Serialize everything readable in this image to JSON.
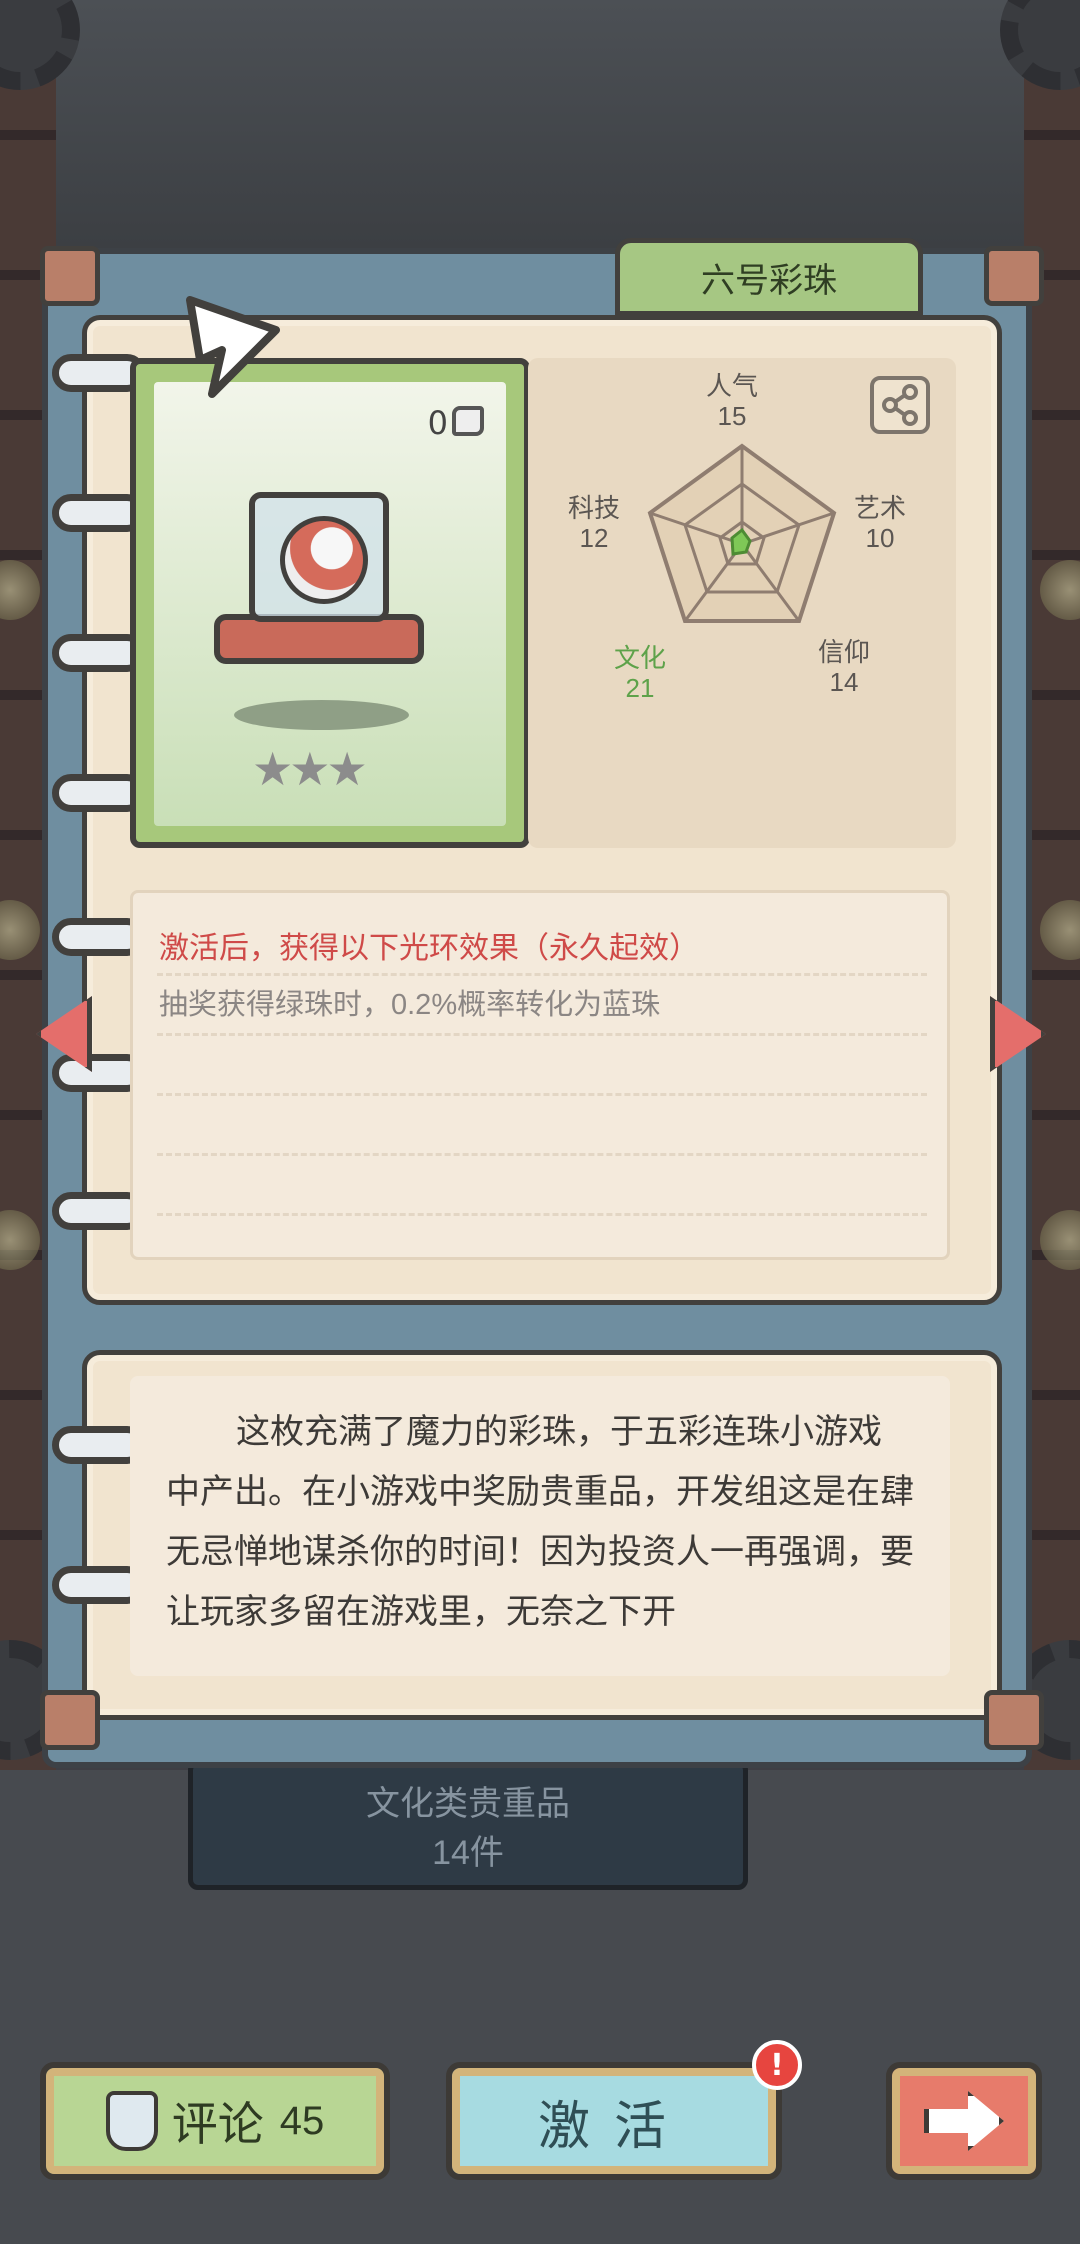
{
  "item": {
    "tab_title": "六号彩珠",
    "fragment_count": "0",
    "stars": "★★★"
  },
  "stats": {
    "renqi": {
      "name": "人气",
      "value": "15"
    },
    "yishu": {
      "name": "艺术",
      "value": "10"
    },
    "xinyang": {
      "name": "信仰",
      "value": "14"
    },
    "wenhua": {
      "name": "文化",
      "value": "21"
    },
    "keji": {
      "name": "科技",
      "value": "12"
    }
  },
  "effect": {
    "title": "激活后，获得以下光环效果（永久起效）",
    "desc": "抽奖获得绿珠时，0.2%概率转化为蓝珠"
  },
  "lore": "这枚充满了魔力的彩珠，于五彩连珠小游戏中产出。在小游戏中奖励贵重品，开发组这是在肆无忌惮地谋杀你的时间！因为投资人一再强调，要让玩家多留在游戏里，无奈之下开",
  "plate": {
    "line1": "文化类贵重品",
    "line2": "14件"
  },
  "buttons": {
    "comment_label": "评论",
    "comment_count": "45",
    "activate_label": "激活",
    "badge": "!"
  },
  "colors": {
    "highlight_stat": "#5ea24a",
    "effect_title": "#cf4a48"
  }
}
